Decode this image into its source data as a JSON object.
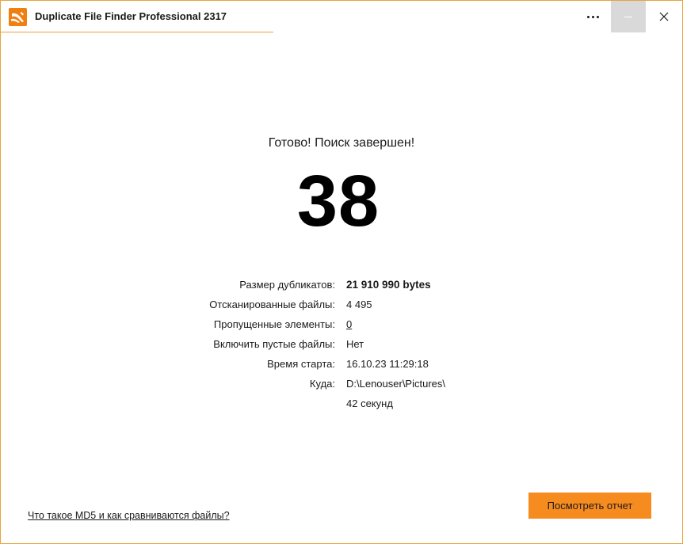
{
  "window": {
    "title": "Duplicate File Finder Professional 2317",
    "accent_color": "#f68b1f",
    "border_color": "#e8a33d"
  },
  "titlebar": {
    "more_icon": "more-dots-icon",
    "minimize_icon": "minimize-icon",
    "close_icon": "close-icon",
    "close_glyph": "✕"
  },
  "result": {
    "status_title": "Готово! Поиск завершен!",
    "duplicate_count": "38"
  },
  "stats": [
    {
      "label": "Размер дубликатов:",
      "value": "21 910 990 bytes"
    },
    {
      "label": "Отсканированные файлы:",
      "value": "4 495"
    },
    {
      "label": "Пропущенные элементы:",
      "value": "0"
    },
    {
      "label": "Включить пустые файлы:",
      "value": "Нет"
    },
    {
      "label": "Время старта:",
      "value": "16.10.23 11:29:18"
    },
    {
      "label": "Куда:",
      "value": "D:\\Lenouser\\Pictures\\"
    },
    {
      "label": "",
      "value": "42 секунд"
    }
  ],
  "footer": {
    "help_link": "Что такое MD5 и как сравниваются файлы?",
    "report_button": "Посмотреть отчет"
  }
}
